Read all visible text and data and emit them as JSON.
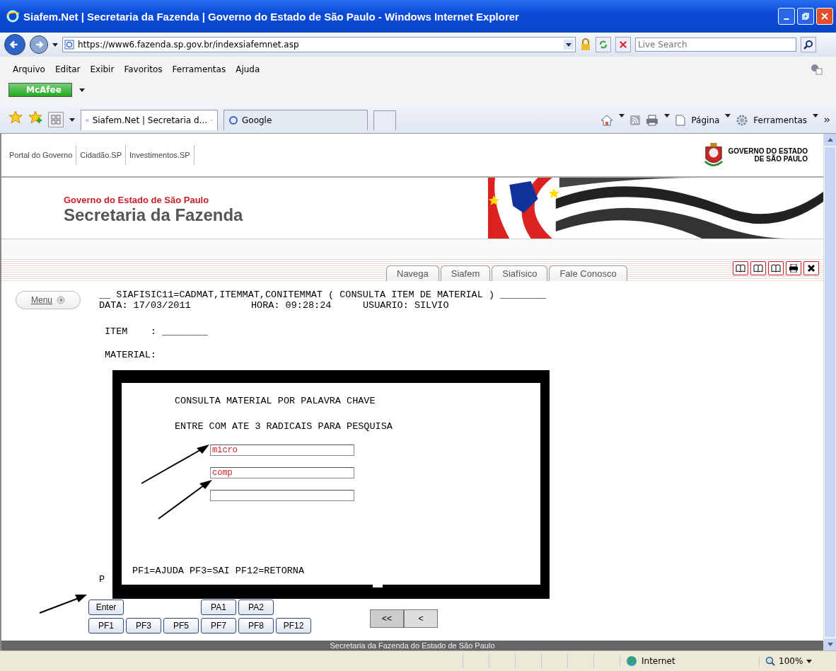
{
  "window": {
    "title": "Siafem.Net | Secretaria da Fazenda | Governo do Estado de São Paulo - Windows Internet Explorer"
  },
  "address_bar": {
    "url": "https://www6.fazenda.sp.gov.br/indexsiafemnet.asp",
    "search_placeholder": "Live Search"
  },
  "menu": [
    "Arquivo",
    "Editar",
    "Exibir",
    "Favoritos",
    "Ferramentas",
    "Ajuda"
  ],
  "mcafee": "McAfee",
  "tabs": [
    {
      "label": "Siafem.Net | Secretaria d...",
      "selected": true
    },
    {
      "label": "Google",
      "selected": false
    }
  ],
  "command_bar": [
    "Página",
    "Ferramentas"
  ],
  "site": {
    "portal_links": [
      "Portal do Governo",
      "Cidadão.SP",
      "Investimentos.SP"
    ],
    "brand": [
      "GOVERNO DO ESTADO",
      "DE SÃO PAULO"
    ],
    "banner": {
      "line1": "Governo do Estado de São Paulo",
      "line2": "Secretaria da Fazenda"
    },
    "nav_tabs": [
      "Navega",
      "Siafem",
      "Siafísico",
      "Fale Conosco"
    ],
    "menu_button": "Menu",
    "footer": "Secretaria da Fazenda do Estado de São Paulo"
  },
  "terminal": {
    "header": "__ SIAFISIC11=CADMAT,ITEMMAT,CONITEMMAT ( CONSULTA ITEM DE MATERIAL ) ________",
    "date": "DATA: 17/03/2011",
    "time": "HORA: 09:28:24",
    "user": "USUARIO: SILVIO",
    "item_label": "ITEM    :",
    "item_value": "________",
    "material_label": "MATERIAL:",
    "partial_line": "P",
    "popup": {
      "title": "CONSULTA MATERIAL POR PALAVRA CHAVE",
      "instruction": "ENTRE COM ATE 3 RADICAIS PARA PESQUISA",
      "fields": [
        {
          "kind": "filled",
          "value": "micro"
        },
        {
          "kind": "filled",
          "value": "comp"
        },
        {
          "kind": "blank"
        }
      ],
      "keys_hint": "PF1=AJUDA PF3=SAI PF12=RETORNA"
    },
    "key_rows": [
      [
        {
          "label": "Enter"
        },
        null,
        null,
        {
          "label": "PA1"
        },
        {
          "label": "PA2"
        }
      ],
      [
        {
          "label": "PF1"
        },
        {
          "label": "PF3"
        },
        {
          "label": "PF5"
        },
        {
          "label": "PF7"
        },
        {
          "label": "PF8"
        },
        {
          "label": "PF12"
        }
      ]
    ],
    "paging": [
      "<<",
      "<"
    ]
  },
  "status_bar": {
    "zone": "Internet",
    "zoom": "100%"
  }
}
